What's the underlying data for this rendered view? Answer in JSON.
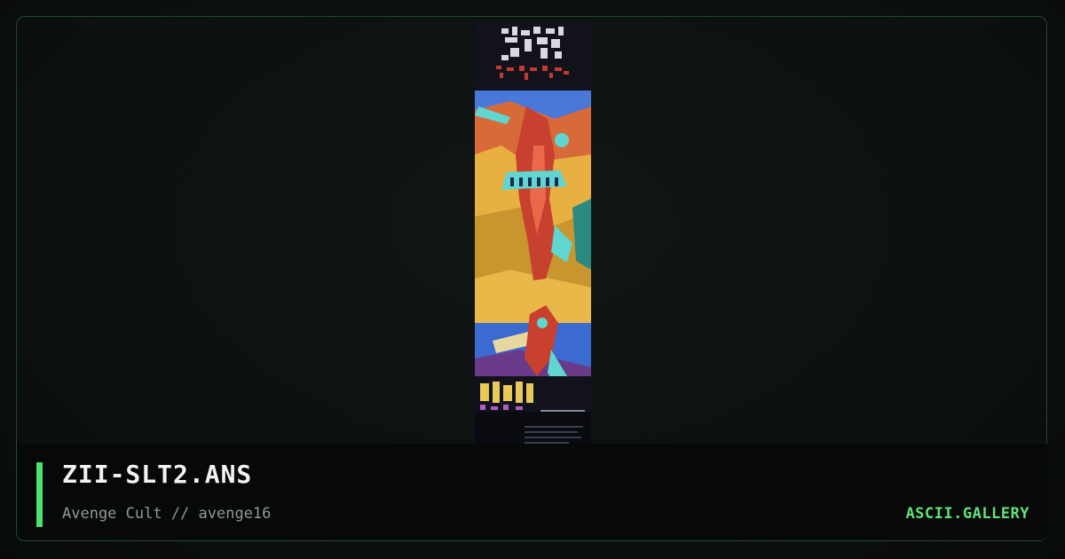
{
  "artwork": {
    "title": "ZII-SLT2.ANS",
    "byline": "Avenge Cult // avenge16",
    "preview_icon": "ansi-art-thumbnail"
  },
  "brand": {
    "label": "ASCII.GALLERY"
  },
  "colors": {
    "accent": "#4ee06a",
    "brand": "#62e07a",
    "frame_border": "#1f4a2a",
    "background": "#0b0f0d"
  }
}
